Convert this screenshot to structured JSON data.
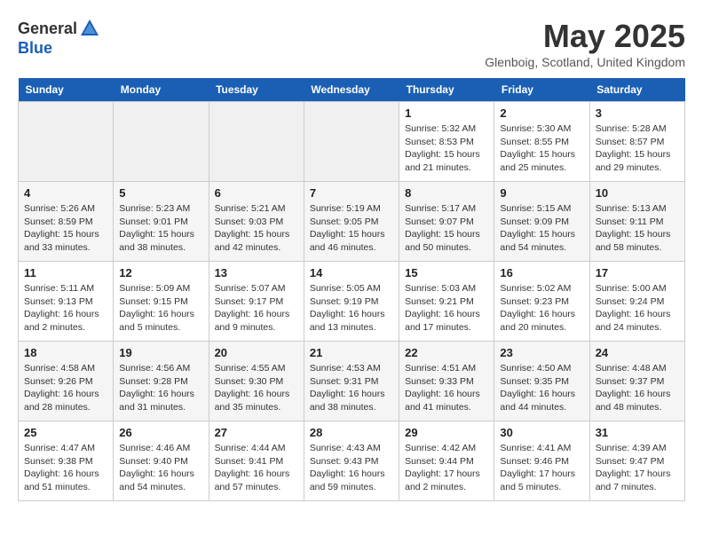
{
  "header": {
    "logo_general": "General",
    "logo_blue": "Blue",
    "month_title": "May 2025",
    "location": "Glenboig, Scotland, United Kingdom"
  },
  "weekdays": [
    "Sunday",
    "Monday",
    "Tuesday",
    "Wednesday",
    "Thursday",
    "Friday",
    "Saturday"
  ],
  "weeks": [
    [
      {
        "day": "",
        "sunrise": "",
        "sunset": "",
        "daylight": ""
      },
      {
        "day": "",
        "sunrise": "",
        "sunset": "",
        "daylight": ""
      },
      {
        "day": "",
        "sunrise": "",
        "sunset": "",
        "daylight": ""
      },
      {
        "day": "",
        "sunrise": "",
        "sunset": "",
        "daylight": ""
      },
      {
        "day": "1",
        "sunrise": "5:32 AM",
        "sunset": "8:53 PM",
        "daylight": "15 hours and 21 minutes."
      },
      {
        "day": "2",
        "sunrise": "5:30 AM",
        "sunset": "8:55 PM",
        "daylight": "15 hours and 25 minutes."
      },
      {
        "day": "3",
        "sunrise": "5:28 AM",
        "sunset": "8:57 PM",
        "daylight": "15 hours and 29 minutes."
      }
    ],
    [
      {
        "day": "4",
        "sunrise": "5:26 AM",
        "sunset": "8:59 PM",
        "daylight": "15 hours and 33 minutes."
      },
      {
        "day": "5",
        "sunrise": "5:23 AM",
        "sunset": "9:01 PM",
        "daylight": "15 hours and 38 minutes."
      },
      {
        "day": "6",
        "sunrise": "5:21 AM",
        "sunset": "9:03 PM",
        "daylight": "15 hours and 42 minutes."
      },
      {
        "day": "7",
        "sunrise": "5:19 AM",
        "sunset": "9:05 PM",
        "daylight": "15 hours and 46 minutes."
      },
      {
        "day": "8",
        "sunrise": "5:17 AM",
        "sunset": "9:07 PM",
        "daylight": "15 hours and 50 minutes."
      },
      {
        "day": "9",
        "sunrise": "5:15 AM",
        "sunset": "9:09 PM",
        "daylight": "15 hours and 54 minutes."
      },
      {
        "day": "10",
        "sunrise": "5:13 AM",
        "sunset": "9:11 PM",
        "daylight": "15 hours and 58 minutes."
      }
    ],
    [
      {
        "day": "11",
        "sunrise": "5:11 AM",
        "sunset": "9:13 PM",
        "daylight": "16 hours and 2 minutes."
      },
      {
        "day": "12",
        "sunrise": "5:09 AM",
        "sunset": "9:15 PM",
        "daylight": "16 hours and 5 minutes."
      },
      {
        "day": "13",
        "sunrise": "5:07 AM",
        "sunset": "9:17 PM",
        "daylight": "16 hours and 9 minutes."
      },
      {
        "day": "14",
        "sunrise": "5:05 AM",
        "sunset": "9:19 PM",
        "daylight": "16 hours and 13 minutes."
      },
      {
        "day": "15",
        "sunrise": "5:03 AM",
        "sunset": "9:21 PM",
        "daylight": "16 hours and 17 minutes."
      },
      {
        "day": "16",
        "sunrise": "5:02 AM",
        "sunset": "9:23 PM",
        "daylight": "16 hours and 20 minutes."
      },
      {
        "day": "17",
        "sunrise": "5:00 AM",
        "sunset": "9:24 PM",
        "daylight": "16 hours and 24 minutes."
      }
    ],
    [
      {
        "day": "18",
        "sunrise": "4:58 AM",
        "sunset": "9:26 PM",
        "daylight": "16 hours and 28 minutes."
      },
      {
        "day": "19",
        "sunrise": "4:56 AM",
        "sunset": "9:28 PM",
        "daylight": "16 hours and 31 minutes."
      },
      {
        "day": "20",
        "sunrise": "4:55 AM",
        "sunset": "9:30 PM",
        "daylight": "16 hours and 35 minutes."
      },
      {
        "day": "21",
        "sunrise": "4:53 AM",
        "sunset": "9:31 PM",
        "daylight": "16 hours and 38 minutes."
      },
      {
        "day": "22",
        "sunrise": "4:51 AM",
        "sunset": "9:33 PM",
        "daylight": "16 hours and 41 minutes."
      },
      {
        "day": "23",
        "sunrise": "4:50 AM",
        "sunset": "9:35 PM",
        "daylight": "16 hours and 44 minutes."
      },
      {
        "day": "24",
        "sunrise": "4:48 AM",
        "sunset": "9:37 PM",
        "daylight": "16 hours and 48 minutes."
      }
    ],
    [
      {
        "day": "25",
        "sunrise": "4:47 AM",
        "sunset": "9:38 PM",
        "daylight": "16 hours and 51 minutes."
      },
      {
        "day": "26",
        "sunrise": "4:46 AM",
        "sunset": "9:40 PM",
        "daylight": "16 hours and 54 minutes."
      },
      {
        "day": "27",
        "sunrise": "4:44 AM",
        "sunset": "9:41 PM",
        "daylight": "16 hours and 57 minutes."
      },
      {
        "day": "28",
        "sunrise": "4:43 AM",
        "sunset": "9:43 PM",
        "daylight": "16 hours and 59 minutes."
      },
      {
        "day": "29",
        "sunrise": "4:42 AM",
        "sunset": "9:44 PM",
        "daylight": "17 hours and 2 minutes."
      },
      {
        "day": "30",
        "sunrise": "4:41 AM",
        "sunset": "9:46 PM",
        "daylight": "17 hours and 5 minutes."
      },
      {
        "day": "31",
        "sunrise": "4:39 AM",
        "sunset": "9:47 PM",
        "daylight": "17 hours and 7 minutes."
      }
    ]
  ],
  "labels": {
    "sunrise_prefix": "Sunrise: ",
    "sunset_prefix": "Sunset: ",
    "daylight_prefix": "Daylight: "
  }
}
